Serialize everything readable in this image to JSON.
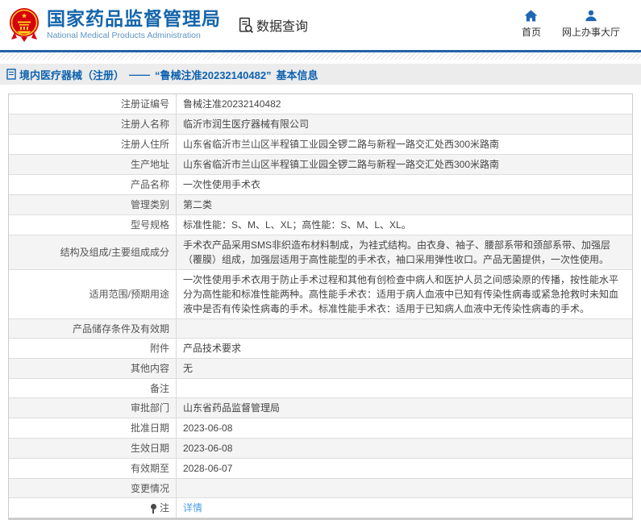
{
  "header": {
    "org_name_cn": "国家药品监督管理局",
    "org_name_en": "National Medical Products Administration",
    "data_query_label": "数据查询",
    "nav_home": "首页",
    "nav_hall": "网上办事大厅"
  },
  "breadcrumb": {
    "section": "境内医疗器械（注册）",
    "separator": "——",
    "record": "“鲁械注准20232140482”",
    "suffix": "基本信息"
  },
  "table": {
    "rows": [
      {
        "label": "注册证编号",
        "value": "鲁械注准20232140482"
      },
      {
        "label": "注册人名称",
        "value": "临沂市润生医疗器械有限公司"
      },
      {
        "label": "注册人住所",
        "value": "山东省临沂市兰山区半程镇工业园全锣二路与新程一路交汇处西300米路南"
      },
      {
        "label": "生产地址",
        "value": "山东省临沂市兰山区半程镇工业园全锣二路与新程一路交汇处西300米路南"
      },
      {
        "label": "产品名称",
        "value": "一次性使用手术衣"
      },
      {
        "label": "管理类别",
        "value": "第二类"
      },
      {
        "label": "型号规格",
        "value": "标准性能：S、M、L、XL；高性能：S、M、L、XL。"
      },
      {
        "label": "结构及组成/主要组成成分",
        "value": "手术衣产品采用SMS非织造布材料制成，为袿式结构。由衣身、袖子、腰部系带和颈部系带、加强层（覆膜）组成，加强层适用于高性能型的手术衣，袖口采用弹性收口。产品无菌提供，一次性使用。"
      },
      {
        "label": "适用范围/预期用途",
        "value": "一次性使用手术衣用于防止手术过程和其他有创检查中病人和医护人员之间感染原的传播，按性能水平分为高性能和标准性能两种。高性能手术衣：适用于病人血液中已知有传染性病毒或紧急抢救时未知血液中是否有传染性病毒的手术。标准性能手术衣：适用于已知病人血液中无传染性病毒的手术。"
      },
      {
        "label": "产品储存条件及有效期",
        "value": ""
      },
      {
        "label": "附件",
        "value": "产品技术要求"
      },
      {
        "label": "其他内容",
        "value": "无"
      },
      {
        "label": "备注",
        "value": ""
      },
      {
        "label": "审批部门",
        "value": "山东省药品监督管理局"
      },
      {
        "label": "批准日期",
        "value": "2023-06-08"
      },
      {
        "label": "生效日期",
        "value": "2023-06-08"
      },
      {
        "label": "有效期至",
        "value": "2028-06-07"
      },
      {
        "label": "变更情况",
        "value": ""
      },
      {
        "label": "注",
        "value": "详情",
        "link": true,
        "label_icon": "note-hint-icon"
      }
    ]
  },
  "colors": {
    "brand_blue": "#1565ab",
    "subtitle_blue": "#5d94c7",
    "nav_icon_blue": "#1f66b5",
    "link_blue": "#4b9cea",
    "emblem_red": "#d6000f",
    "emblem_gold": "#ffd21e",
    "alt_row_bg": "#f4f4f4",
    "breadcrumb_bg": "#ececec",
    "header_line_blue": "#2263a7"
  }
}
